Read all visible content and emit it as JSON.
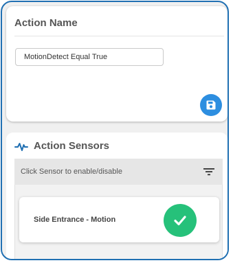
{
  "action_name": {
    "title": "Action Name",
    "input_value": "MotionDetect Equal True"
  },
  "action_sensors": {
    "title": "Action Sensors",
    "filter_hint": "Click Sensor to enable/disable",
    "sensors": [
      {
        "name": "Side Entrance - Motion",
        "enabled": true
      }
    ]
  },
  "icons": {
    "save": "save-floppy-icon",
    "pulse": "activity-pulse-icon",
    "filter": "filter-icon",
    "check": "check-icon"
  },
  "colors": {
    "frame_border": "#1f6fb2",
    "save_button": "#2d8ee0",
    "pulse_icon": "#1f6fb2",
    "enabled_check": "#26c17a",
    "panel_background": "#f0f0f0"
  }
}
